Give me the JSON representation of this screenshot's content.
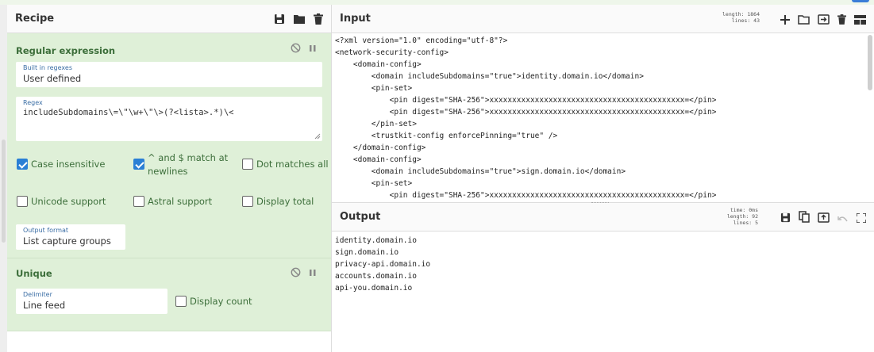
{
  "recipe": {
    "title": "Recipe",
    "ops": [
      {
        "name": "Regular expression",
        "builtin_label": "Built in regexes",
        "builtin_value": "User defined",
        "regex_label": "Regex",
        "regex_value": "includeSubdomains\\=\\\"\\w+\\\"\\>(?<lista>.*)\\<",
        "options": [
          {
            "label": "Case insensitive",
            "checked": true
          },
          {
            "label": "^ and $ match at",
            "label2": "newlines",
            "checked": true
          },
          {
            "label": "Dot matches all",
            "checked": false
          },
          {
            "label": "Unicode support",
            "checked": false
          },
          {
            "label": "Astral support",
            "checked": false
          },
          {
            "label": "Display total",
            "checked": false
          }
        ],
        "output_format_label": "Output format",
        "output_format_value": "List capture groups"
      },
      {
        "name": "Unique",
        "delimiter_label": "Delimiter",
        "delimiter_value": "Line feed",
        "display_count_label": "Display count",
        "display_count_checked": false
      }
    ]
  },
  "input": {
    "title": "Input",
    "length_label": "length:",
    "length_value": "1864",
    "lines_label": "lines:",
    "lines_value": "43",
    "text": "<?xml version=\"1.0\" encoding=\"utf-8\"?>\n<network-security-config>\n    <domain-config>\n        <domain includeSubdomains=\"true\">identity.domain.io</domain>\n        <pin-set>\n            <pin digest=\"SHA-256\">xxxxxxxxxxxxxxxxxxxxxxxxxxxxxxxxxxxxxxxxxxx=</pin>\n            <pin digest=\"SHA-256\">xxxxxxxxxxxxxxxxxxxxxxxxxxxxxxxxxxxxxxxxxxx=</pin>\n        </pin-set>\n        <trustkit-config enforcePinning=\"true\" />\n    </domain-config>\n    <domain-config>\n        <domain includeSubdomains=\"true\">sign.domain.io</domain>\n        <pin-set>\n            <pin digest=\"SHA-256\">xxxxxxxxxxxxxxxxxxxxxxxxxxxxxxxxxxxxxxxxxxx=</pin>"
  },
  "output": {
    "title": "Output",
    "time_label": "time:",
    "time_value": "0ms",
    "length_label": "length:",
    "length_value": "92",
    "lines_label": "lines:",
    "lines_value": "5",
    "text": "identity.domain.io\nsign.domain.io\nprivacy-api.domain.io\naccounts.domain.io\napi-you.domain.io"
  },
  "colors": {
    "op_bg": "#dff0d8",
    "op_title": "#3c6e3a",
    "checkbox_on": "#2a7fd5"
  },
  "icons": {
    "recipe_header": [
      "save-icon",
      "folder-icon",
      "trash-icon"
    ],
    "input_header": [
      "plus-icon",
      "folder-icon",
      "load-file-icon",
      "trash-icon",
      "layout-icon"
    ],
    "output_header": [
      "save-icon",
      "copy-icon",
      "replace-input-icon",
      "undo-icon",
      "maximize-icon"
    ],
    "op_controls": [
      "disable-icon",
      "pause-icon"
    ]
  }
}
